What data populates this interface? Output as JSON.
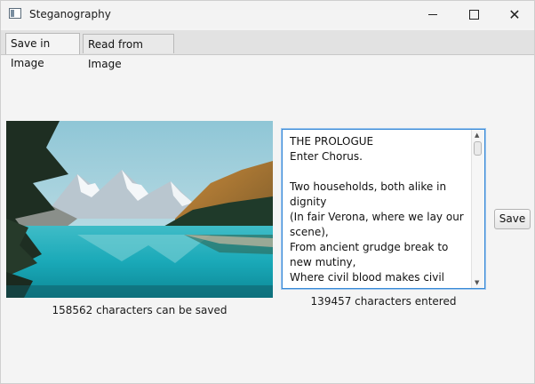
{
  "window": {
    "title": "Steganography",
    "controls": [
      "minimize",
      "maximize",
      "close"
    ]
  },
  "tabs": [
    {
      "label": "Save in Image",
      "active": true
    },
    {
      "label": "Read from Image",
      "active": false
    }
  ],
  "image_panel": {
    "image_alt": "mountain lake landscape",
    "caption": "158562 characters can be saved"
  },
  "text_panel": {
    "content": "THE PROLOGUE\nEnter Chorus.\n\nTwo households, both alike in dignity\n(In fair Verona, where we lay our scene),\nFrom ancient grudge break to new mutiny,\nWhere civil blood makes civil hands unclean.\nFrom forth the fatal loins of these",
    "caption": "139457 characters entered"
  },
  "actions": {
    "save_label": "Save"
  },
  "colors": {
    "focus_border": "#3a8ad6",
    "window_bg": "#f4f4f4"
  }
}
